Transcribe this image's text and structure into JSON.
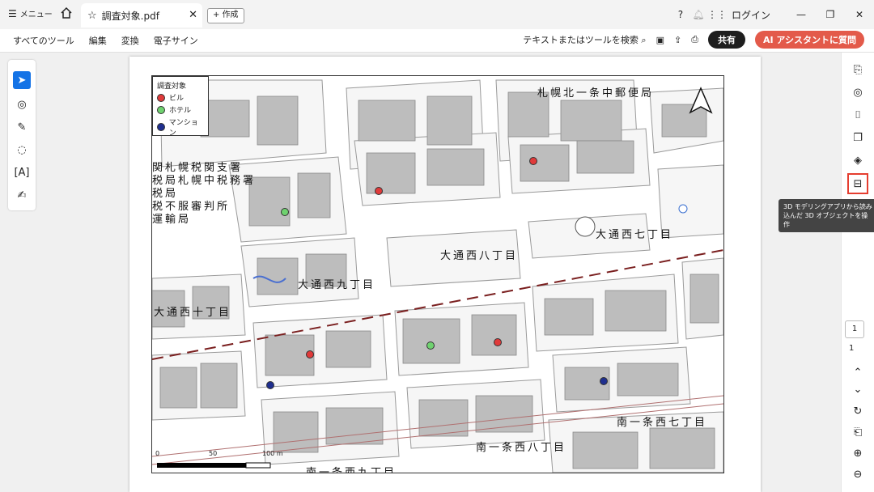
{
  "titlebar": {
    "menu_label": "メニュー",
    "tab_title": "調査対象.pdf",
    "new_tab_label": "作成",
    "login_label": "ログイン"
  },
  "toolbar": {
    "items": [
      "すべてのツール",
      "編集",
      "変換",
      "電子サイン"
    ],
    "search_label": "テキストまたはツールを検索",
    "share_label": "共有",
    "ai_label": "AI アシスタントに質問"
  },
  "tooltip": "3D モデリングアプリから読み込んだ 3D オブジェクトを操作",
  "page_nav": {
    "current": "1",
    "total": "1"
  },
  "map": {
    "legend_title": "調査対象",
    "legend_items": [
      {
        "label": "ビル",
        "color": "#e03a3a"
      },
      {
        "label": "ホテル",
        "color": "#6fd26f"
      },
      {
        "label": "マンション",
        "color": "#1f2f8f"
      }
    ],
    "labels": {
      "post_office": "札幌北一条中郵便局",
      "w8": "大通西八丁目",
      "w7": "大通西七丁目",
      "w9": "大通西九丁目",
      "w10": "大通西十丁目",
      "s1w7": "南一条西七丁目",
      "s1w8": "南一条西八丁目",
      "s1w9": "南一条西九丁目",
      "tax1": "関札幌税関支署",
      "tax2": "税局札幌中税務署",
      "tax3": "税局",
      "tax4": "税不服審判所",
      "tax5": "運輸局"
    },
    "scale": {
      "s0": "0",
      "s50": "50",
      "s100": "100 m"
    }
  },
  "colors": {
    "accent": "#1473e6",
    "highlight": "#e53e30",
    "ai": "#e35a4a"
  }
}
